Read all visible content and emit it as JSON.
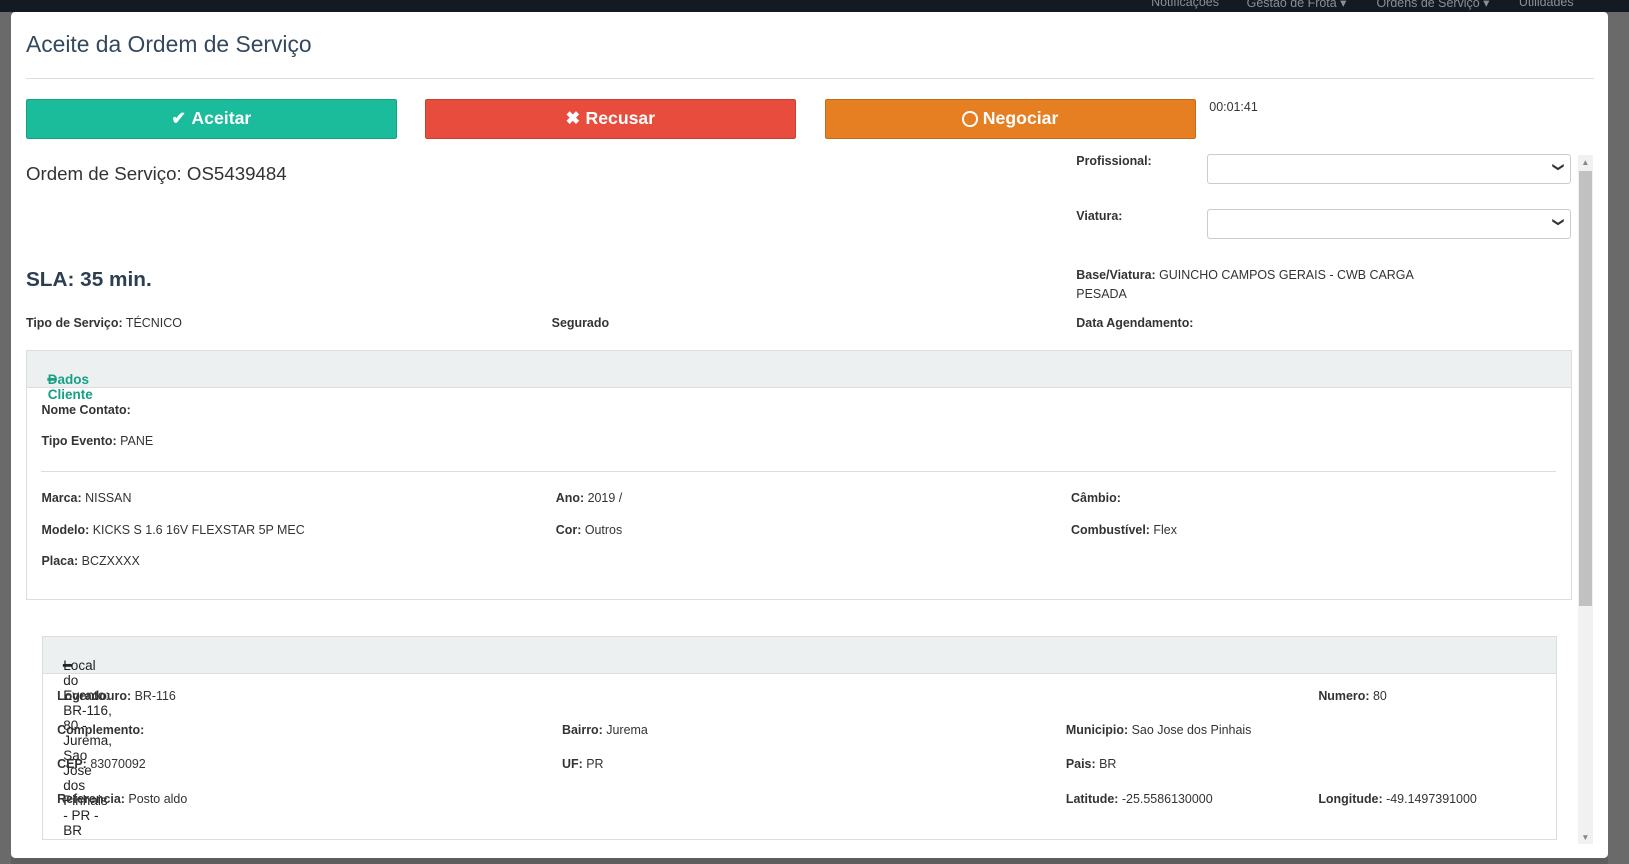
{
  "background_nav": [
    "Notificações",
    "Gestão de Frota ▾",
    "Ordens de Serviço ▾",
    "Utilidades"
  ],
  "modal": {
    "title": "Aceite da Ordem de Serviço",
    "buttons": {
      "accept": "Aceitar",
      "refuse": "Recusar",
      "negotiate": "Negociar"
    },
    "timer": "00:01:41",
    "order": "Ordem de Serviço: OS5439484",
    "sla": "SLA: 35 min.",
    "profissional_label": "Profissional:",
    "viatura_label": "Viatura:",
    "base_label": "Base/Viatura:",
    "base_value": "GUINCHO CAMPOS GERAIS - CWB CARGA",
    "base_value2": "PESADA",
    "tipo_servico_label": "Tipo de Serviço:",
    "tipo_servico": "TÉCNICO",
    "segurado_label": "Segurado",
    "data_agendamento_label": "Data Agendamento:"
  },
  "cliente": {
    "header": "Dados Cliente",
    "nome_contato": "Nome Contato:",
    "tipo_evento_label": "Tipo Evento:",
    "tipo_evento": "PANE",
    "marca_label": "Marca:",
    "marca": "NISSAN",
    "ano_label": "Ano:",
    "ano": "2019 /",
    "cambio_label": "Câmbio:",
    "modelo_label": "Modelo:",
    "modelo": "KICKS S 1.6 16V FLEXSTAR 5P MEC",
    "cor_label": "Cor:",
    "cor": "Outros",
    "combustivel_label": "Combustível:",
    "combustivel": "Flex",
    "placa_label": "Placa:",
    "placa": "BCZXXXX"
  },
  "local": {
    "header": "Local do Evento: BR-116, 80 - Jurema, Sao Jose dos Pinhais - PR - BR",
    "logradouro_label": "Logradouro:",
    "logradouro": "BR-116",
    "numero_label": "Numero:",
    "numero": "80",
    "complemento_label": "Complemento:",
    "bairro_label": "Bairro:",
    "bairro": "Jurema",
    "municipio_label": "Municipio:",
    "municipio": "Sao Jose dos Pinhais",
    "cep_label": "CEP:",
    "cep": "83070092",
    "uf_label": "UF:",
    "uf": "PR",
    "pais_label": "Pais:",
    "pais": "BR",
    "referencia_label": "Referencia:",
    "referencia": "Posto aldo",
    "latitude_label": "Latitude:",
    "latitude": "-25.5586130000",
    "longitude_label": "Longitude:",
    "longitude": "-49.1497391000"
  },
  "colors": {
    "accept": "#1abc9c",
    "refuse": "#e74c3c",
    "negotiate": "#e67e22"
  }
}
